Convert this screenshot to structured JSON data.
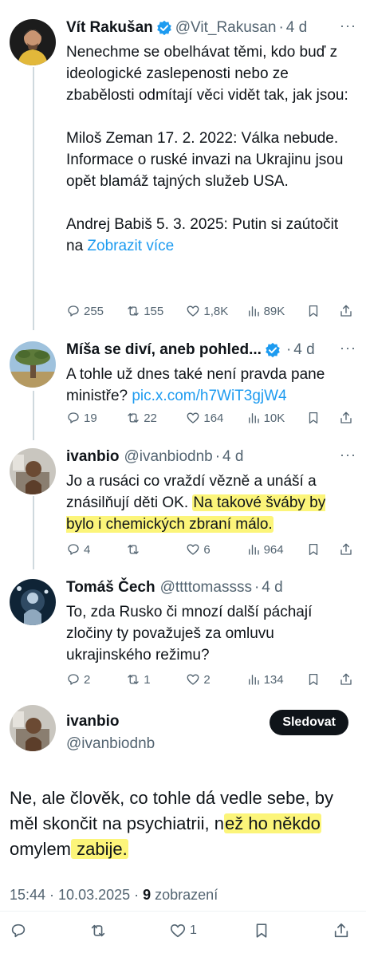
{
  "tweets": [
    {
      "name": "Vít Rakušan",
      "handle": "@Vit_Rakusan",
      "age": "4 d",
      "verified": true,
      "text_a": "Nenechme se obelhávat těmi, kdo buď z ideologické zaslepenosti nebo ze zbabělosti odmítají věci vidět tak, jak jsou:\n\nMiloš Zeman 17. 2. 2022: Válka nebude. Informace o ruské invazi na Ukrajinu jsou opět blamáž tajných služeb USA.\n\nAndrej Babiš 5. 3. 2025: Putin si zaútočit na ",
      "link": "Zobrazit více",
      "replies": "255",
      "reposts": "155",
      "likes": "1,8K",
      "views": "89K"
    },
    {
      "name": "Míša se diví, aneb pohled...",
      "age": "4 d",
      "verified": true,
      "text_a": "A tohle už dnes také není pravda pane ministře? ",
      "link": "pic.x.com/h7WiT3gjW4",
      "replies": "19",
      "reposts": "22",
      "likes": "164",
      "views": "10K"
    },
    {
      "name": "ivanbio",
      "handle": "@ivanbiodnb",
      "age": "4 d",
      "text_a": "Jo a rusáci co vraždí vězně a unáší a znásilňují děti OK. ",
      "highlight": "Na takové šváby by bylo i chemických zbraní málo.",
      "likes": "6",
      "views": "964",
      "replies": "4"
    },
    {
      "name": "Tomáš Čech",
      "handle": "@ttttomassss",
      "age": "4 d",
      "text_a": "To, zda Rusko či mnozí další páchají zločiny ty považuješ za omluvu ukrajinského režimu?",
      "replies": "2",
      "reposts": "1",
      "likes": "2",
      "views": "134"
    }
  ],
  "main": {
    "name": "ivanbio",
    "handle": "@ivanbiodnb",
    "follow_label": "Sledovat",
    "text_a": "Ne, ale člověk, co tohle dá vedle sebe, by měl skončit na psychiatrii, n",
    "highlight_1": "ež ho někdo",
    "text_b": " omylem",
    "highlight_2": " zabije.",
    "time": "15:44 · 10.03.2025 · ",
    "views_count": "9",
    "views_label": " zobrazení",
    "likes": "1"
  },
  "icons": [
    "verified-badge-icon",
    "more-icon",
    "reply-icon",
    "repost-icon",
    "like-icon",
    "views-icon",
    "bookmark-icon",
    "share-icon"
  ],
  "colors": {
    "accent": "#1d9bf0",
    "text": "#0f1419",
    "muted": "#536471",
    "highlight": "#fcf57a"
  }
}
